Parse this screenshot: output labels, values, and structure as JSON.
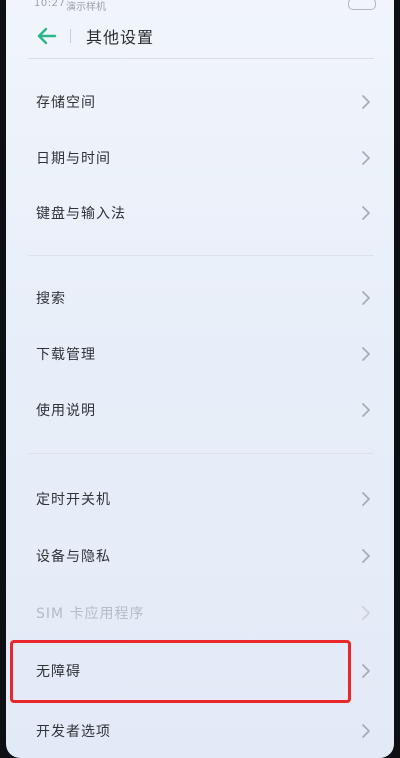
{
  "status_bar": {
    "time": "10:27",
    "carrier": "演示样机"
  },
  "header": {
    "title": "其他设置",
    "back_icon": "arrow-left-icon"
  },
  "colors": {
    "accent": "#2bb58a",
    "highlight": "#e8282a",
    "chevron": "#a7adb6"
  },
  "groups": [
    {
      "items": [
        {
          "id": "storage",
          "label": "存储空间"
        },
        {
          "id": "date-time",
          "label": "日期与时间"
        },
        {
          "id": "keyboard-input",
          "label": "键盘与输入法"
        }
      ]
    },
    {
      "items": [
        {
          "id": "search",
          "label": "搜索"
        },
        {
          "id": "downloads",
          "label": "下载管理"
        },
        {
          "id": "manual",
          "label": "使用说明"
        }
      ]
    },
    {
      "items": [
        {
          "id": "scheduled-power",
          "label": "定时开关机"
        },
        {
          "id": "device-privacy",
          "label": "设备与隐私"
        },
        {
          "id": "sim-apps",
          "label": "SIM 卡应用程序",
          "disabled": true
        },
        {
          "id": "accessibility",
          "label": "无障碍",
          "highlighted": true
        },
        {
          "id": "developer-options",
          "label": "开发者选项"
        }
      ]
    }
  ]
}
